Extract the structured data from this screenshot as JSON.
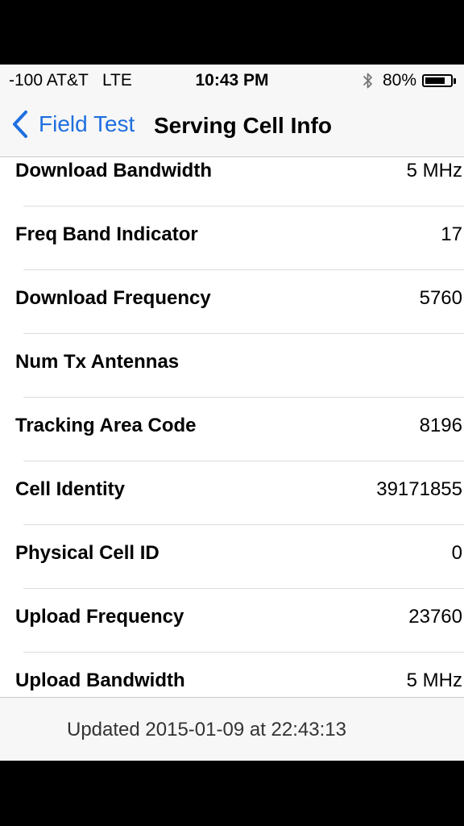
{
  "status_bar": {
    "carrier": "-100 AT&T   LTE",
    "time": "10:43 PM",
    "battery_percent": "80%",
    "battery_level": 0.8,
    "bluetooth_icon": "bluetooth-icon"
  },
  "nav": {
    "back_label": "Field Test",
    "title": "Serving Cell Info",
    "accent_color": "#1f6fe0"
  },
  "rows": [
    {
      "label": "Download Bandwidth",
      "value": "5 MHz"
    },
    {
      "label": "Freq Band Indicator",
      "value": "17"
    },
    {
      "label": "Download Frequency",
      "value": "5760"
    },
    {
      "label": "Num Tx Antennas",
      "value": ""
    },
    {
      "label": "Tracking Area Code",
      "value": "8196"
    },
    {
      "label": "Cell Identity",
      "value": "39171855"
    },
    {
      "label": "Physical Cell ID",
      "value": "0"
    },
    {
      "label": "Upload Frequency",
      "value": "23760"
    },
    {
      "label": "Upload Bandwidth",
      "value": "5 MHz"
    }
  ],
  "footer": {
    "updated_text": "Updated 2015-01-09 at 22:43:13"
  }
}
